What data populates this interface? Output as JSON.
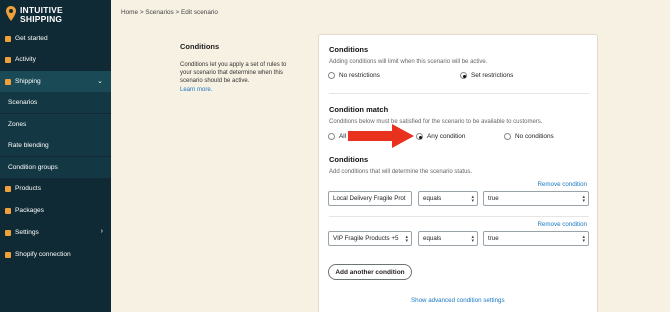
{
  "app": {
    "logo_line1": "INTUITIVE",
    "logo_line2": "SHIPPING",
    "logo_icon": "location-pin-icon",
    "accent_color": "#f0a03a",
    "sidebar_bg": "#0f2a35"
  },
  "sidebar": {
    "items": [
      {
        "label": "Get started",
        "icon": "rocket-icon"
      },
      {
        "label": "Activity",
        "icon": "activity-icon"
      },
      {
        "label": "Shipping",
        "icon": "truck-icon"
      },
      {
        "label": "Scenarios"
      },
      {
        "label": "Zones"
      },
      {
        "label": "Rate blending"
      },
      {
        "label": "Condition groups"
      },
      {
        "label": "Products",
        "icon": "tag-icon"
      },
      {
        "label": "Packages",
        "icon": "box-icon"
      },
      {
        "label": "Settings",
        "icon": "gear-icon"
      },
      {
        "label": "Shopify connection",
        "icon": "link-icon"
      }
    ]
  },
  "breadcrumb": "Home > Scenarios > Edit scenario",
  "left_panel": {
    "title": "Conditions",
    "description": "Conditions let you apply a set of rules to your scenario that determine when this scenario should be active.",
    "learn_more": "Learn more."
  },
  "conditions": {
    "title": "Conditions",
    "description": "Adding conditions will limit when this scenario will be active.",
    "option_no_restrictions": "No restrictions",
    "option_set_restrictions": "Set restrictions",
    "selected": "Set restrictions"
  },
  "condition_match": {
    "title": "Condition match",
    "description": "Conditions below must be satisfied for the scenario to be available to customers.",
    "option_all": "All",
    "option_any": "Any condition",
    "option_none": "No conditions",
    "selected": "Any condition"
  },
  "conditions_list": {
    "title": "Conditions",
    "description": "Add conditions that will determine the scenario status.",
    "remove_label": "Remove condition",
    "rows": [
      {
        "field": "Local Delivery Fragile Prot",
        "operator": "equals",
        "value": "true"
      },
      {
        "field": "VIP Fragile Products +5",
        "operator": "equals",
        "value": "true"
      }
    ],
    "add_button": "Add another condition",
    "advanced_link": "Show advanced condition settings"
  }
}
